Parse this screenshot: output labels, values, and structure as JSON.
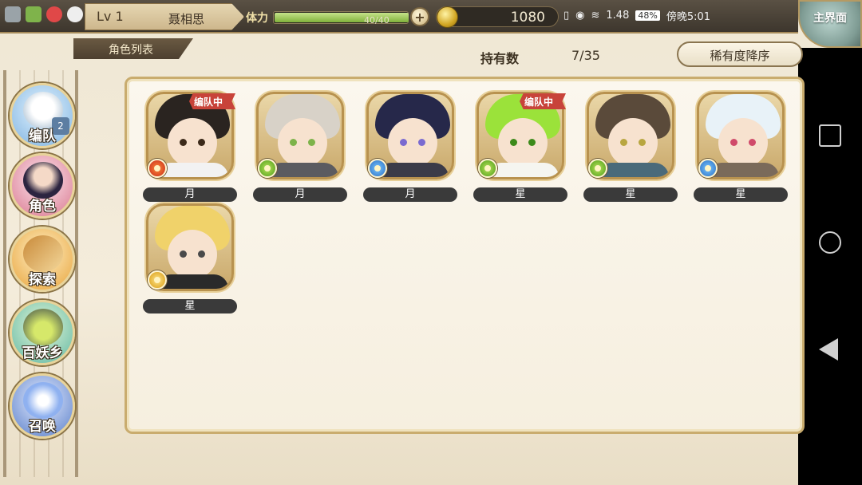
{
  "header": {
    "level": "Lv 1",
    "player_name": "聂相思",
    "stamina_label": "体力",
    "stamina_value": "40/40",
    "gold": "1080",
    "status_signal": "1.48",
    "status_battery": "48%",
    "status_time": "傍晚5:01",
    "main_menu_label": "主界面"
  },
  "page": {
    "title": "角色列表",
    "holding_label": "持有数",
    "holding_count": "7/35",
    "sort_label": "稀有度降序"
  },
  "side_menu": [
    {
      "label": "编队",
      "badge": "2"
    },
    {
      "label": "角色"
    },
    {
      "label": "探索"
    },
    {
      "label": "百妖乡"
    },
    {
      "label": "召唤"
    }
  ],
  "characters": [
    {
      "category": "月",
      "element": "fire-icon",
      "in_team_label": "编队中",
      "hair": "#2a2420",
      "eyes": "#3c2a1a",
      "outfit": "#f2f2f2"
    },
    {
      "category": "月",
      "element": "wind-icon",
      "in_team_label": "",
      "hair": "#d8d2c8",
      "eyes": "#7db34a",
      "outfit": "#5b5b60"
    },
    {
      "category": "月",
      "element": "water-icon",
      "in_team_label": "",
      "hair": "#26284a",
      "eyes": "#7a6ad0",
      "outfit": "#3b3b48"
    },
    {
      "category": "星",
      "element": "wind-icon",
      "in_team_label": "编队中",
      "hair": "#9be23a",
      "eyes": "#3c8a1a",
      "outfit": "#f5f5f0"
    },
    {
      "category": "星",
      "element": "wind-icon",
      "in_team_label": "",
      "hair": "#5a4a3a",
      "eyes": "#b8a640",
      "outfit": "#4a6a7a"
    },
    {
      "category": "星",
      "element": "water-icon",
      "in_team_label": "",
      "hair": "#e8f2f8",
      "eyes": "#d04a6a",
      "outfit": "#7a6a5a"
    },
    {
      "category": "星",
      "element": "light-icon",
      "in_team_label": "",
      "hair": "#f0d26a",
      "eyes": "#4a4a4a",
      "outfit": "#2a2a2a"
    }
  ],
  "stamina_fill": 1.0
}
